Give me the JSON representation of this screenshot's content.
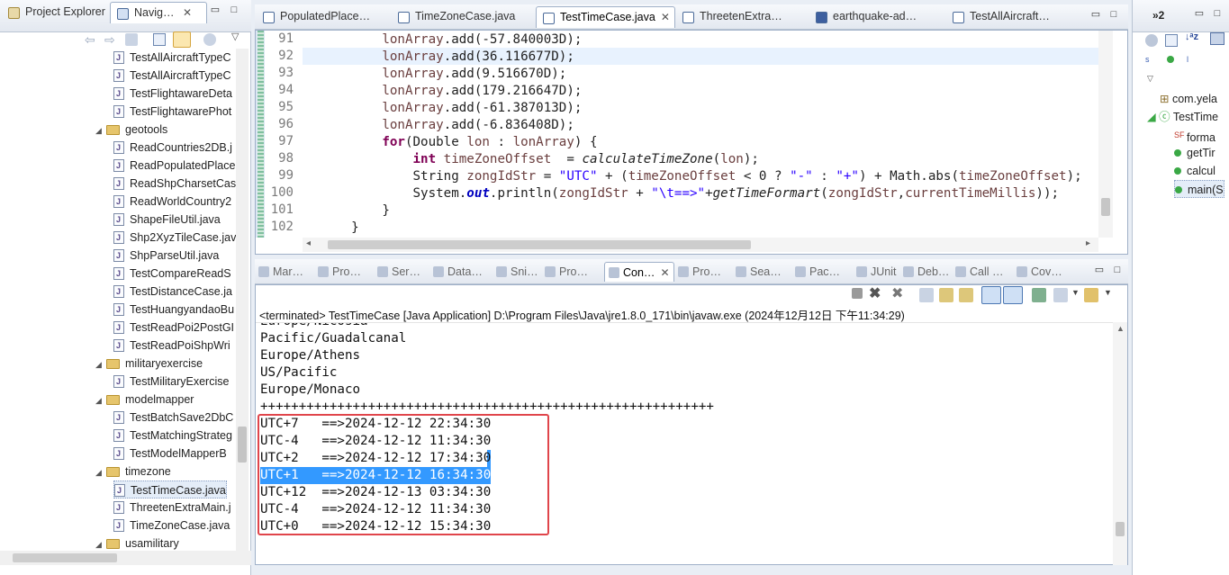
{
  "left_panel": {
    "tabs": [
      "Project Explorer",
      "Navig…"
    ],
    "tree": [
      {
        "label": "TestAllAircraftTypeC",
        "type": "file",
        "indent": 2
      },
      {
        "label": "TestAllAircraftTypeC",
        "type": "file",
        "indent": 2
      },
      {
        "label": "TestFlightawareDeta",
        "type": "file",
        "indent": 2
      },
      {
        "label": "TestFlightawarePhot",
        "type": "file",
        "indent": 2
      },
      {
        "label": "geotools",
        "type": "folder",
        "indent": 1
      },
      {
        "label": "ReadCountries2DB.j",
        "type": "file",
        "indent": 2
      },
      {
        "label": "ReadPopulatedPlace",
        "type": "file",
        "indent": 2
      },
      {
        "label": "ReadShpCharsetCas",
        "type": "file",
        "indent": 2
      },
      {
        "label": "ReadWorldCountry2",
        "type": "file",
        "indent": 2
      },
      {
        "label": "ShapeFileUtil.java",
        "type": "file",
        "indent": 2
      },
      {
        "label": "Shp2XyzTileCase.jav",
        "type": "file",
        "indent": 2
      },
      {
        "label": "ShpParseUtil.java",
        "type": "file",
        "indent": 2
      },
      {
        "label": "TestCompareReadS",
        "type": "file",
        "indent": 2
      },
      {
        "label": "TestDistanceCase.ja",
        "type": "file",
        "indent": 2
      },
      {
        "label": "TestHuangyandaoBu",
        "type": "file",
        "indent": 2
      },
      {
        "label": "TestReadPoi2PostGI",
        "type": "file",
        "indent": 2
      },
      {
        "label": "TestReadPoiShpWri",
        "type": "file",
        "indent": 2
      },
      {
        "label": "militaryexercise",
        "type": "folder",
        "indent": 1
      },
      {
        "label": "TestMilitaryExercise",
        "type": "file",
        "indent": 2
      },
      {
        "label": "modelmapper",
        "type": "folder",
        "indent": 1
      },
      {
        "label": "TestBatchSave2DbC",
        "type": "file",
        "indent": 2
      },
      {
        "label": "TestMatchingStrateg",
        "type": "file",
        "indent": 2
      },
      {
        "label": "TestModelMapperB",
        "type": "file",
        "indent": 2
      },
      {
        "label": "timezone",
        "type": "folder",
        "indent": 1
      },
      {
        "label": "TestTimeCase.java",
        "type": "file",
        "indent": 2,
        "selected": true
      },
      {
        "label": "ThreetenExtraMain.j",
        "type": "file",
        "indent": 2
      },
      {
        "label": "TimeZoneCase.java",
        "type": "file",
        "indent": 2
      },
      {
        "label": "usamilitary",
        "type": "folder",
        "indent": 1
      }
    ]
  },
  "editor": {
    "tabs": [
      "PopulatedPlace…",
      "TimeZoneCase.java",
      "TestTimeCase.java",
      "ThreetenExtra…",
      "earthquake-ad…",
      "TestAllAircraft…"
    ],
    "active_tab": 2,
    "lines": [
      {
        "n": "91",
        "code": "        lonArray.add(-57.840003D);"
      },
      {
        "n": "92",
        "code": "        lonArray.add(36.116677D);"
      },
      {
        "n": "93",
        "code": "        lonArray.add(9.516670D);"
      },
      {
        "n": "94",
        "code": "        lonArray.add(179.216647D);"
      },
      {
        "n": "95",
        "code": "        lonArray.add(-61.387013D);"
      },
      {
        "n": "96",
        "code": "        lonArray.add(-6.836408D);"
      },
      {
        "n": "97",
        "code": "        for(Double lon : lonArray) {"
      },
      {
        "n": "98",
        "code": "            int timeZoneOffset  = calculateTimeZone(lon);"
      },
      {
        "n": "99",
        "code": "            String zongIdStr = \"UTC\" + (timeZoneOffset < 0 ? \"-\" : \"+\") + Math.abs(timeZoneOffset);"
      },
      {
        "n": "100",
        "code": "            System.out.println(zongIdStr + \"\\t==>\"+getTimeFormart(zongIdStr,currentTimeMillis));"
      },
      {
        "n": "101",
        "code": "        }"
      },
      {
        "n": "102",
        "code": "    }"
      }
    ]
  },
  "console": {
    "tabs": [
      "Mar…",
      "Pro…",
      "Ser…",
      "Data…",
      "Sni…",
      "Pro…",
      "Con…",
      "Pro…",
      "Sea…",
      "Pac…",
      "JUnit",
      "Deb…",
      "Call …",
      "Cov…"
    ],
    "active_tab": 6,
    "status": "<terminated> TestTimeCase [Java Application] D:\\Program Files\\Java\\jre1.8.0_171\\bin\\javaw.exe (2024年12月12日 下午11:34:29)",
    "lines": [
      "Europe/Nicosia",
      "Pacific/Guadalcanal",
      "Europe/Athens",
      "US/Pacific",
      "Europe/Monaco",
      "+++++++++++++++++++++++++++++++++++++++++++++++++++++++++++",
      "UTC+7   ==>2024-12-12 22:34:30",
      "UTC-4   ==>2024-12-12 11:34:30",
      "UTC+2   ==>2024-12-12 17:34:30",
      "UTC+1   ==>2024-12-12 16:34:30",
      "UTC+12  ==>2024-12-13 03:34:30",
      "UTC-4   ==>2024-12-12 11:34:30",
      "UTC+0   ==>2024-12-12 15:34:30"
    ],
    "selected_line": 9
  },
  "outline": {
    "tab": "»2",
    "items": [
      {
        "label": "com.yela",
        "kind": "package"
      },
      {
        "label": "TestTime",
        "kind": "class"
      },
      {
        "label": "forma",
        "kind": "field",
        "mod": "SF"
      },
      {
        "label": "getTir",
        "kind": "method",
        "mod": "S"
      },
      {
        "label": "calcul",
        "kind": "method",
        "mod": "S"
      },
      {
        "label": "main(S",
        "kind": "method",
        "mod": "S",
        "selected": true
      }
    ]
  },
  "colors": {
    "selection": "#3399ff",
    "highlight_box": "#e0454b",
    "current_line": "#e8f2fe",
    "keyword": "#7f0055",
    "string": "#2a00ff"
  }
}
